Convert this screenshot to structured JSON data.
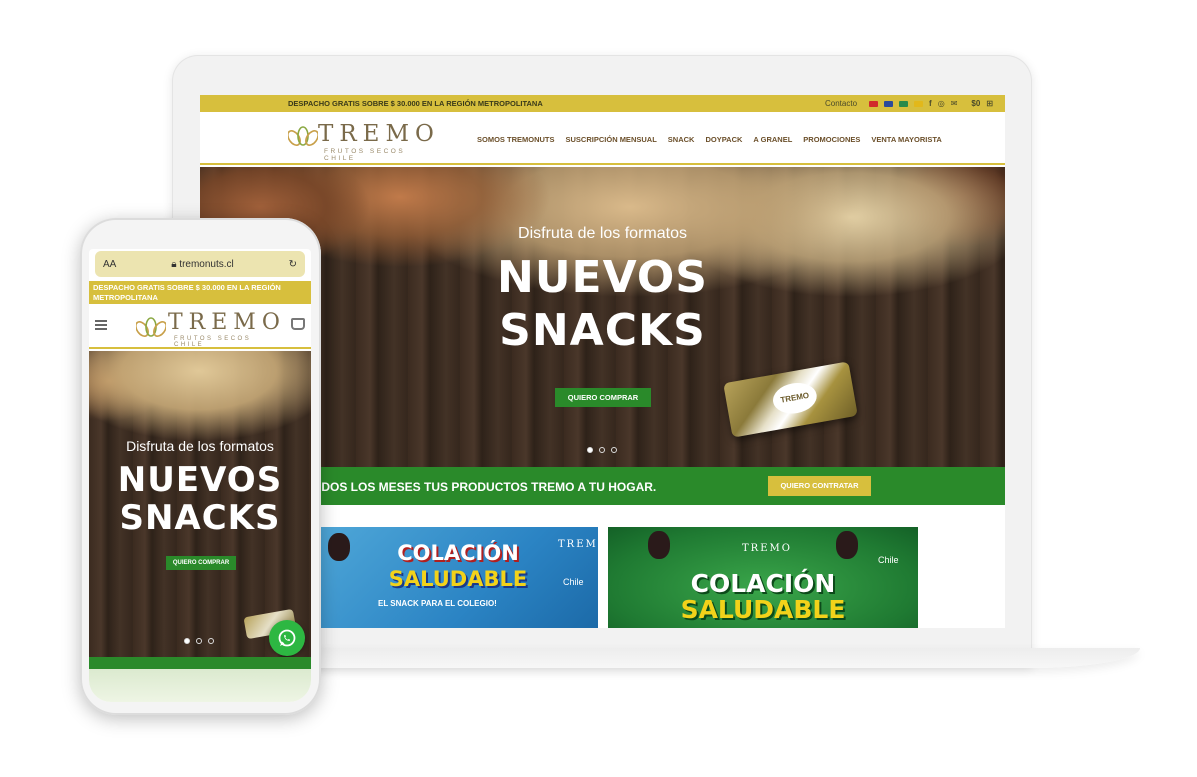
{
  "desktop": {
    "topbar": {
      "shipping_text": "DESPACHO GRATIS SOBRE $ 30.000 EN LA REGIÓN METROPOLITANA",
      "contact_label": "Contacto",
      "flags": [
        "#d12b2b",
        "#2a4a9a",
        "#2a8a4a",
        "#e2b81a"
      ],
      "social_icons": [
        "facebook-icon",
        "instagram-icon",
        "email-icon"
      ],
      "social_glyphs": [
        "f",
        "◎",
        "✉"
      ],
      "cart_label": "$0"
    },
    "logo": {
      "brand": "TREMO",
      "tagline": "FRUTOS SECOS CHILE"
    },
    "menu": [
      "SOMOS TREMONUTS",
      "SUSCRIPCIÓN MENSUAL",
      "SNACK",
      "DOYPACK",
      "A GRANEL",
      "PROMOCIONES",
      "VENTA MAYORISTA"
    ],
    "hero": {
      "subtitle": "Disfruta de los formatos",
      "title_line1": "NUEVOS",
      "title_line2": "SNACKS",
      "button": "QUIERO COMPRAR",
      "product_label": "TREMO"
    },
    "subscription_bar": {
      "text": "ODOS LOS MESES TUS PRODUCTOS TREMO A TU HOGAR.",
      "button": "QUIERO CONTRATAR"
    },
    "promo1": {
      "title1": "COLACIÓN",
      "title2": "SALUDABLE",
      "subtitle": "EL SNACK PARA EL COLEGIO!",
      "brand": "TREMO",
      "country": "Chile"
    },
    "promo2": {
      "title1": "COLACIÓN",
      "title2": "SALUDABLE",
      "brand": "TREMO",
      "country": "Chile"
    }
  },
  "mobile": {
    "url": "tremonuts.cl",
    "text_size_label": "AA",
    "shipping_text": "DESPACHO GRATIS SOBRE $ 30.000 EN LA REGIÓN METROPOLITANA",
    "logo": {
      "brand": "TREMO",
      "tagline": "FRUTOS SECOS CHILE"
    },
    "hero": {
      "subtitle": "Disfruta de los formatos",
      "title_line1": "NUEVOS",
      "title_line2": "SNACKS",
      "button": "QUIERO COMPRAR"
    }
  },
  "colors": {
    "gold": "#d7bf3d",
    "green": "#2a8a2a",
    "brown_text": "#6b4f2a",
    "whatsapp": "#2db742"
  }
}
